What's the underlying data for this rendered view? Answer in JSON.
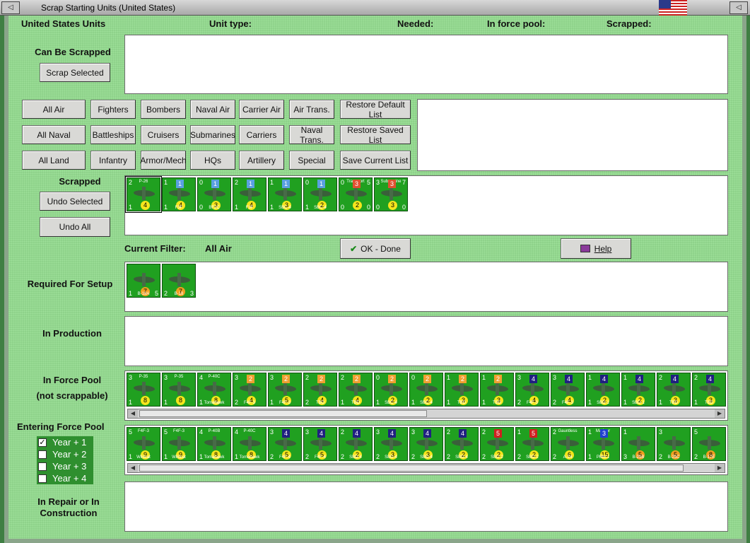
{
  "window": {
    "title": "Scrap Starting Units (United States)",
    "min_icon": "minimize-icon",
    "close_icon": "close-icon",
    "flag": "us-flag-icon"
  },
  "header": {
    "country_units": "United States Units",
    "unit_type": "Unit type:",
    "needed": "Needed:",
    "in_force_pool": "In force pool:",
    "scrapped": "Scrapped:"
  },
  "sections": {
    "can_be_scrapped": "Can Be Scrapped",
    "scrapped": "Scrapped",
    "current_filter_label": "Current Filter:",
    "current_filter_value": "All Air",
    "required_for_setup": "Required For Setup",
    "in_production": "In Production",
    "in_force_pool_1": "In Force Pool",
    "in_force_pool_2": "(not scrappable)",
    "entering_force_pool": "Entering Force Pool",
    "in_repair_1": "In Repair or In",
    "in_repair_2": "Construction"
  },
  "buttons": {
    "scrap_selected": "Scrap Selected",
    "undo_selected": "Undo Selected",
    "undo_all": "Undo All",
    "ok_done": "OK - Done",
    "help": "Help"
  },
  "filters": [
    [
      "All Air",
      "Fighters",
      "Bombers",
      "Naval Air",
      "Carrier Air",
      "Air Trans.",
      "Restore Default List"
    ],
    [
      "All Naval",
      "Battleships",
      "Cruisers",
      "Submarines",
      "Carriers",
      "Naval Trans.",
      "Restore Saved List"
    ],
    [
      "All Land",
      "Infantry",
      "Armor/Mech",
      "HQs",
      "Artillery",
      "Special",
      "Save Current List"
    ]
  ],
  "year_options": [
    {
      "label": "Year + 1",
      "checked": true
    },
    {
      "label": "Year + 2",
      "checked": false
    },
    {
      "label": "Year + 3",
      "checked": false
    },
    {
      "label": "Year + 4",
      "checked": false
    }
  ],
  "scrapped_units": [
    {
      "tl": "2",
      "tp": "P-26",
      "yc": "4",
      "bl": "1",
      "nm": "",
      "br": ""
    },
    {
      "tl": "1",
      "sq": "1",
      "sqc": "#5aa0e0",
      "yc": "4",
      "bl": "1",
      "nm": "F3F",
      "br": ""
    },
    {
      "tl": "0",
      "sq": "1",
      "sqc": "#5aa0e0",
      "yc": "3",
      "bl": "0",
      "nm": "BF2C",
      "br": ""
    },
    {
      "tl": "2",
      "sq": "1",
      "sqc": "#5aa0e0",
      "yc": "4",
      "bl": "1",
      "nm": "F3F",
      "br": ""
    },
    {
      "tl": "1",
      "sq": "1",
      "sqc": "#5aa0e0",
      "yc": "3",
      "bl": "1",
      "nm": "SBC-4",
      "br": ""
    },
    {
      "tl": "0",
      "sq": "1",
      "sqc": "#5aa0e0",
      "yc": "2",
      "bl": "1",
      "nm": "SBC-4",
      "br": ""
    },
    {
      "tl": "0",
      "tr": "5",
      "sq": "3",
      "sqc": "#e05030",
      "tp": "Transport",
      "yc": "2",
      "bl": "0",
      "nm": "",
      "br": "0"
    },
    {
      "tl": "3",
      "tr": "7",
      "sq": "3",
      "sqc": "#e05030",
      "tp": "Submarine",
      "yc": "3",
      "bl": "0",
      "nm": "",
      "br": "0"
    }
  ],
  "required_units": [
    {
      "tl": "",
      "tp": "",
      "yc": "7",
      "bl": "1",
      "nm": "B-18A",
      "br": "5",
      "ycc": "#f0a020"
    },
    {
      "tl": "",
      "tp": "",
      "yc": "7",
      "bl": "2",
      "nm": "B-18",
      "br": "3",
      "ycc": "#f0a020"
    }
  ],
  "force_pool_units": [
    {
      "tl": "3",
      "tp": "P-35",
      "yc": "8",
      "bl": "1",
      "nm": ""
    },
    {
      "tl": "3",
      "tp": "P-35",
      "yc": "8",
      "bl": "1",
      "nm": ""
    },
    {
      "tl": "4",
      "tp": "P-40C",
      "yc": "8",
      "bl": "1",
      "nm": "Tomahawk"
    },
    {
      "tl": "3",
      "sq": "2",
      "sqc": "#f0a030",
      "yc": "4",
      "bl": "2",
      "nm": "F4F-3"
    },
    {
      "tl": "3",
      "sq": "2",
      "sqc": "#f0a030",
      "yc": "5",
      "bl": "1",
      "nm": "F4F-3"
    },
    {
      "tl": "2",
      "sq": "2",
      "sqc": "#f0a030",
      "yc": "4",
      "bl": "2",
      "nm": "TBD"
    },
    {
      "tl": "2",
      "sq": "2",
      "sqc": "#f0a030",
      "yc": "4",
      "bl": "1",
      "nm": "TBD"
    },
    {
      "tl": "0",
      "sq": "2",
      "sqc": "#f0a030",
      "yc": "2",
      "bl": "1",
      "nm": "SBC-4"
    },
    {
      "tl": "0",
      "sq": "2",
      "sqc": "#f0a030",
      "yc": "2",
      "bl": "1",
      "nm": "SBC-4"
    },
    {
      "tl": "1",
      "sq": "2",
      "sqc": "#f0a030",
      "yc": "3",
      "bl": "1",
      "nm": "TBD"
    },
    {
      "tl": "1",
      "sq": "2",
      "sqc": "#f0a030",
      "yc": "3",
      "bl": "1",
      "nm": "TBD"
    },
    {
      "tl": "3",
      "sq": "4",
      "sqc": "#202080",
      "yc": "4",
      "bl": "2",
      "nm": "F4F-3"
    },
    {
      "tl": "3",
      "sq": "4",
      "sqc": "#202080",
      "yc": "4",
      "bl": "2",
      "nm": "F4F-3"
    },
    {
      "tl": "1",
      "sq": "4",
      "sqc": "#202080",
      "yc": "2",
      "bl": "1",
      "nm": "SBD-1"
    },
    {
      "tl": "1",
      "sq": "4",
      "sqc": "#202080",
      "yc": "2",
      "bl": "1",
      "nm": "SBD-1"
    },
    {
      "tl": "2",
      "sq": "4",
      "sqc": "#202080",
      "yc": "3",
      "bl": "1",
      "nm": "TBD"
    },
    {
      "tl": "2",
      "sq": "4",
      "sqc": "#202080",
      "yc": "3",
      "bl": "1",
      "nm": "TBD"
    }
  ],
  "entering_units": [
    {
      "tl": "5",
      "tp": "F4F-3",
      "yc": "9",
      "bl": "1",
      "nm": "Wildcat"
    },
    {
      "tl": "5",
      "tp": "F4F-3",
      "yc": "9",
      "bl": "1",
      "nm": "Wildcat"
    },
    {
      "tl": "4",
      "tp": "P-40B",
      "yc": "8",
      "bl": "1",
      "nm": "Tomahawk"
    },
    {
      "tl": "4",
      "tp": "P-40C",
      "yc": "8",
      "bl": "1",
      "nm": "Tomahawk"
    },
    {
      "tl": "3",
      "sq": "4",
      "sqc": "#202080",
      "yc": "5",
      "bl": "2",
      "nm": "F4F-4"
    },
    {
      "tl": "3",
      "sq": "4",
      "sqc": "#202080",
      "yc": "5",
      "bl": "2",
      "nm": "F4F-4"
    },
    {
      "tl": "2",
      "sq": "4",
      "sqc": "#202080",
      "yc": "2",
      "bl": "2",
      "nm": "SBD-4"
    },
    {
      "tl": "3",
      "sq": "4",
      "sqc": "#202080",
      "yc": "3",
      "bl": "2",
      "nm": "SBD-4"
    },
    {
      "tl": "3",
      "sq": "4",
      "sqc": "#202080",
      "yc": "3",
      "bl": "2",
      "nm": "SBD-4"
    },
    {
      "tl": "2",
      "sq": "4",
      "sqc": "#202080",
      "yc": "2",
      "bl": "2",
      "nm": "SBD-4"
    },
    {
      "tl": "2",
      "sq": "5",
      "sqc": "#d02020",
      "yc": "2",
      "bl": "2",
      "nm": "SBD-2"
    },
    {
      "tl": "1",
      "sq": "5",
      "sqc": "#d02020",
      "yc": "2",
      "bl": "2",
      "nm": "SBD-2"
    },
    {
      "tl": "2",
      "tp": "Gauntless",
      "yc": "6",
      "bl": "2",
      "nm": "A-24"
    },
    {
      "tl": "1",
      "tp": "Mariner",
      "sq": "3",
      "sqc": "#2040d0",
      "yc": "15",
      "bl": "1",
      "nm": "PBM-1"
    },
    {
      "tl": "1",
      "tp": "",
      "yc": "5",
      "bl": "3",
      "nm": "B-25B",
      "ycc": "#f0a020"
    },
    {
      "tl": "3",
      "tp": "",
      "yc": "5",
      "bl": "2",
      "nm": "B-25C",
      "ycc": "#f0a020"
    },
    {
      "tl": "5",
      "tp": "",
      "yc": "8",
      "bl": "2",
      "nm": "B-17E",
      "ycc": "#f0a020"
    }
  ]
}
